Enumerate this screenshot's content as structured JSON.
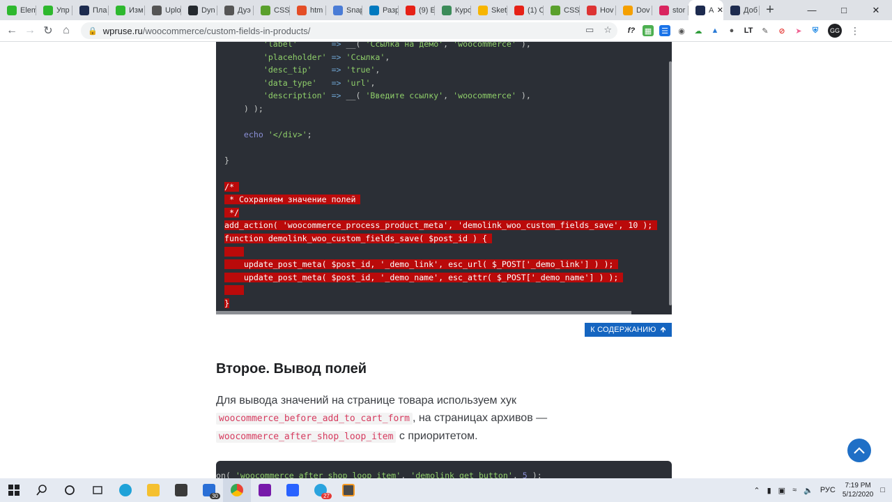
{
  "browser": {
    "tabs": [
      {
        "label": "Elem",
        "icon": "leaf-icon",
        "color": "#2eb82e"
      },
      {
        "label": "Упр",
        "icon": "leaf-icon",
        "color": "#2eb82e"
      },
      {
        "label": "Пла",
        "icon": "code-brackets-icon",
        "color": "#1d2b4f"
      },
      {
        "label": "Изм",
        "icon": "leaf-icon",
        "color": "#2eb82e"
      },
      {
        "label": "Uplo",
        "icon": "diamond-icon",
        "color": "#555555"
      },
      {
        "label": "Dyn",
        "icon": "github-icon",
        "color": "#24292e"
      },
      {
        "label": "Дуэ",
        "icon": "wordpress-icon",
        "color": "#555555"
      },
      {
        "label": "CSS",
        "icon": "css-icon",
        "color": "#5aa02c"
      },
      {
        "label": "htm",
        "icon": "html-icon",
        "color": "#e44d26"
      },
      {
        "label": "Snap",
        "icon": "gear-icon",
        "color": "#4a7cd6"
      },
      {
        "label": "Разр",
        "icon": "trello-icon",
        "color": "#0079bf"
      },
      {
        "label": "(9) E",
        "icon": "youtube-icon",
        "color": "#e62117"
      },
      {
        "label": "Курс",
        "icon": "person-icon",
        "color": "#3c8c5a"
      },
      {
        "label": "Sket",
        "icon": "sketch-icon",
        "color": "#f7b500"
      },
      {
        "label": "(1) C",
        "icon": "youtube-icon",
        "color": "#e62117"
      },
      {
        "label": "CSS",
        "icon": "css-icon",
        "color": "#5aa02c"
      },
      {
        "label": "Hov",
        "icon": "flag-icon",
        "color": "#d33"
      },
      {
        "label": "Dov",
        "icon": "bolt-icon",
        "color": "#f5a000"
      },
      {
        "label": "stor",
        "icon": "gear-red-icon",
        "color": "#d9255f"
      },
      {
        "label": "A",
        "icon": "code-brackets-icon",
        "color": "#1d2b4f",
        "active": true
      },
      {
        "label": "Доб",
        "icon": "code-brackets-icon",
        "color": "#1d2b4f"
      }
    ],
    "url_domain": "wpruse.ru",
    "url_path": "/woocommerce/custom-fields-in-products/",
    "profile_initials": "GG"
  },
  "code_lines": [
    {
      "parts": [
        {
          "t": "        "
        },
        {
          "t": "'label'",
          "c": "s"
        },
        {
          "t": "       "
        },
        {
          "t": "=>",
          "c": "o"
        },
        {
          "t": " __( "
        },
        {
          "t": "'Ссылка на демо'",
          "c": "s"
        },
        {
          "t": ", "
        },
        {
          "t": "'woocommerce'",
          "c": "s"
        },
        {
          "t": " ),"
        }
      ]
    },
    {
      "parts": [
        {
          "t": "        "
        },
        {
          "t": "'placeholder'",
          "c": "s"
        },
        {
          "t": " "
        },
        {
          "t": "=>",
          "c": "o"
        },
        {
          "t": " "
        },
        {
          "t": "'Ссылка'",
          "c": "s"
        },
        {
          "t": ","
        }
      ]
    },
    {
      "parts": [
        {
          "t": "        "
        },
        {
          "t": "'desc_tip'",
          "c": "s"
        },
        {
          "t": "    "
        },
        {
          "t": "=>",
          "c": "o"
        },
        {
          "t": " "
        },
        {
          "t": "'true'",
          "c": "s"
        },
        {
          "t": ","
        }
      ]
    },
    {
      "parts": [
        {
          "t": "        "
        },
        {
          "t": "'data_type'",
          "c": "s"
        },
        {
          "t": "   "
        },
        {
          "t": "=>",
          "c": "o"
        },
        {
          "t": " "
        },
        {
          "t": "'url'",
          "c": "s"
        },
        {
          "t": ","
        }
      ]
    },
    {
      "parts": [
        {
          "t": "        "
        },
        {
          "t": "'description'",
          "c": "s"
        },
        {
          "t": " "
        },
        {
          "t": "=>",
          "c": "o"
        },
        {
          "t": " __( "
        },
        {
          "t": "'Введите ссылку'",
          "c": "s"
        },
        {
          "t": ", "
        },
        {
          "t": "'woocommerce'",
          "c": "s"
        },
        {
          "t": " ),"
        }
      ]
    },
    {
      "parts": [
        {
          "t": "    ) );"
        }
      ]
    },
    {
      "parts": [
        {
          "t": ""
        }
      ]
    },
    {
      "parts": [
        {
          "t": "    "
        },
        {
          "t": "echo",
          "c": "k"
        },
        {
          "t": " "
        },
        {
          "t": "'</div>'",
          "c": "s"
        },
        {
          "t": ";"
        }
      ]
    },
    {
      "parts": [
        {
          "t": ""
        }
      ]
    },
    {
      "parts": [
        {
          "t": "}"
        }
      ]
    },
    {
      "parts": [
        {
          "t": ""
        }
      ]
    },
    {
      "hl": "/* "
    },
    {
      "hl": " * Сохраняем значение полей "
    },
    {
      "hl": " */"
    },
    {
      "hl": "add_action( 'woocommerce_process_product_meta', 'demolink_woo_custom_fields_save', 10 ); "
    },
    {
      "hl": "function demolink_woo_custom_fields_save( $post_id ) { "
    },
    {
      "hl": "    "
    },
    {
      "hl": "    update_post_meta( $post_id, '_demo_link', esc_url( $_POST['_demo_link'] ) ); "
    },
    {
      "hl": "    update_post_meta( $post_id, '_demo_name', esc_attr( $_POST['_demo_name'] ) ); "
    },
    {
      "hl": "    "
    },
    {
      "hl": "}"
    }
  ],
  "toc_button": "К СОДЕРЖАНИЮ",
  "heading": "Второе. Вывод полей",
  "paragraph": {
    "p1": "Для вывода значений на странице товара используем хук ",
    "code1": "woocommerce_before_add_to_cart_form",
    "p2": ", на страницах архивов — ",
    "code2": "woocommerce_after_shop_loop_item",
    "p3": " с приоритетом."
  },
  "code2": {
    "prefix": "on( ",
    "s1": "'woocommerce_after_shop_loop_item'",
    "mid": ", ",
    "s2": "'demolink_get_button'",
    "mid2": ", ",
    "num": "5",
    "suffix": " );"
  },
  "taskbar": {
    "mail_badge": "30",
    "telegram_badge": "27",
    "lang": "РУС",
    "time": "7:19 PM",
    "date": "5/12/2020"
  }
}
